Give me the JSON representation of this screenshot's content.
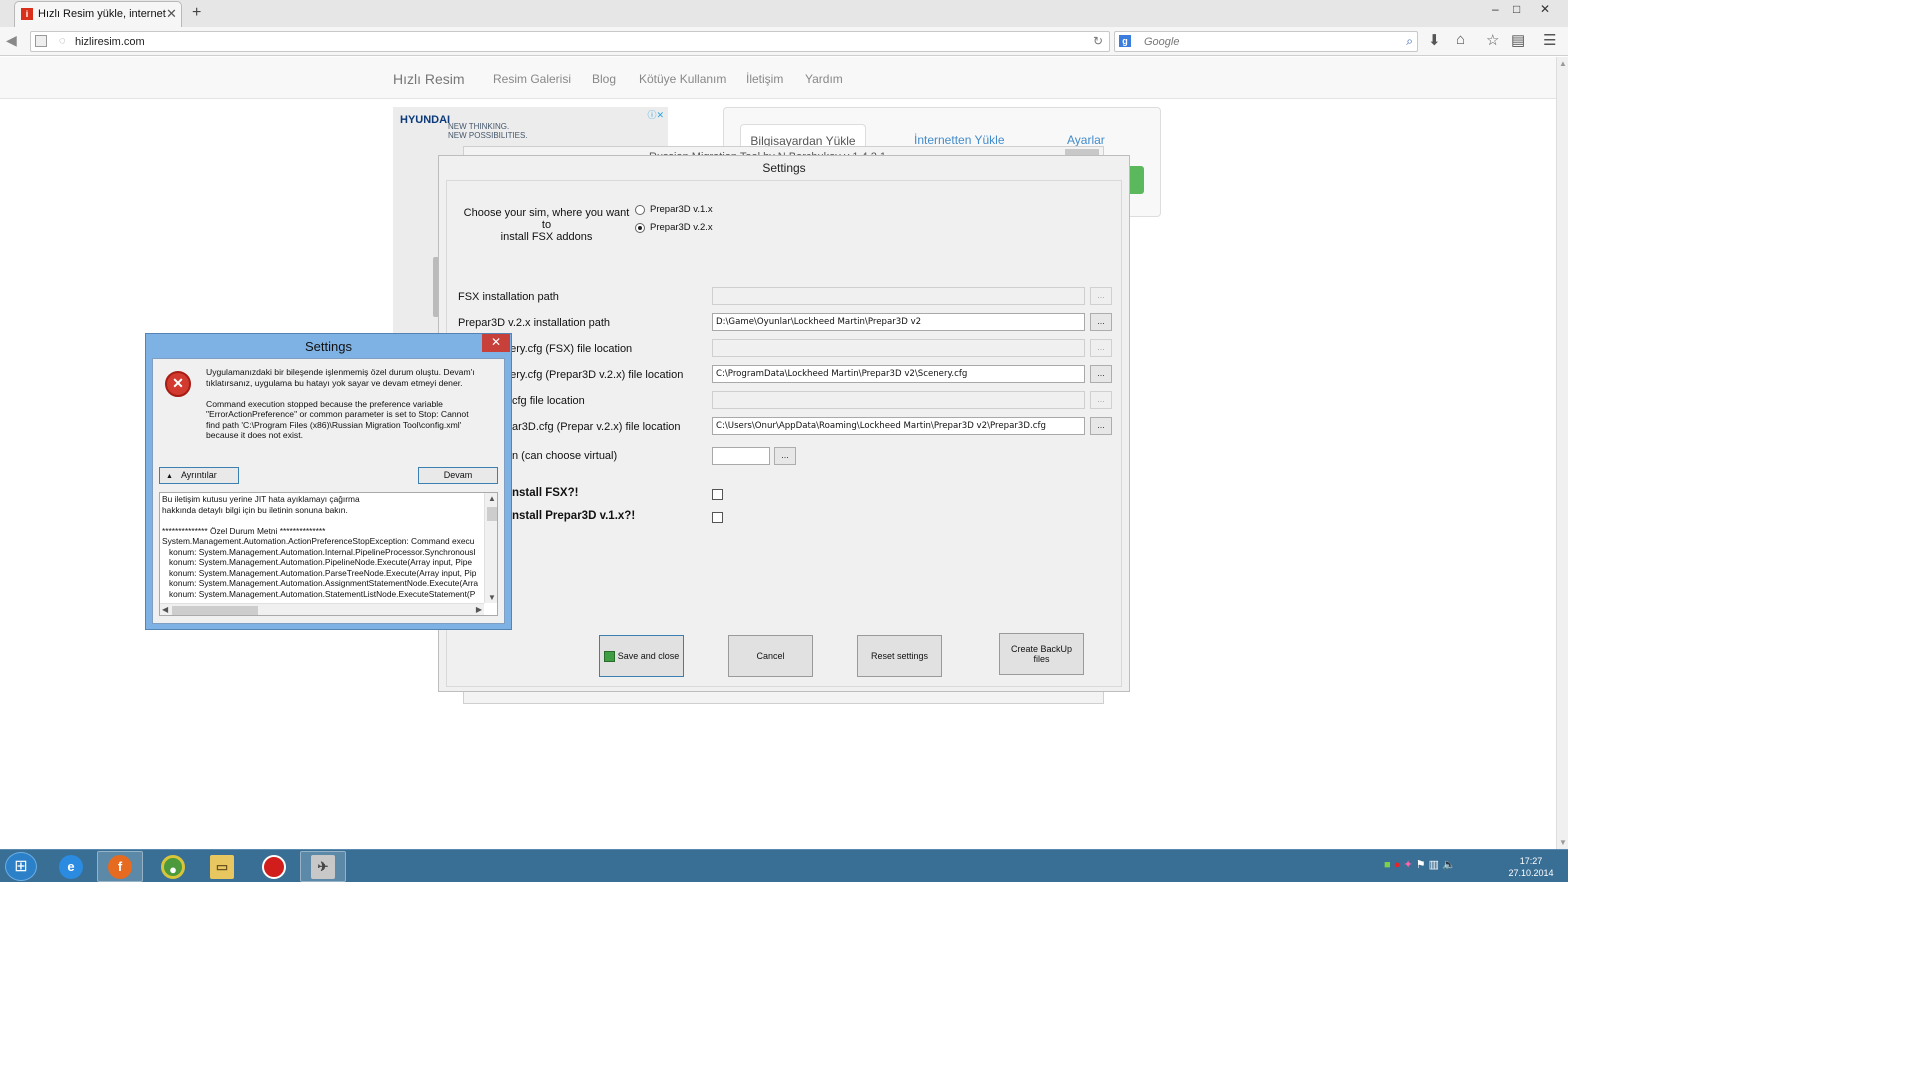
{
  "browser": {
    "tab_title": "Hızlı Resim yükle, internett...",
    "tab_icon": "letter-i-favicon",
    "new_tab": "+",
    "url": "hizliresim.com",
    "search_placeholder": "Google",
    "window_controls": [
      "–",
      "□",
      "✕"
    ]
  },
  "site": {
    "brand": "Hızlı Resim",
    "nav": [
      "Resim Galerisi",
      "Blog",
      "Kötüye Kullanım",
      "İletişim",
      "Yardım"
    ],
    "upload_tabs": [
      "Bilgisayardan Yükle",
      "İnternetten Yükle",
      "Ayarlar"
    ],
    "ad_brand": "HYUNDAI",
    "ad_tagline_1": "NEW THINKING.",
    "ad_tagline_2": "NEW POSSIBILITIES."
  },
  "bgwindow": {
    "title": "Russian Migration Tool by N.Barchukov v 1.4.2.1"
  },
  "settings": {
    "title": "Settings",
    "sim_prompt_line1": "Choose your sim, where you want to",
    "sim_prompt_line2": "install FSX addons",
    "options": [
      {
        "label": "Prepar3D v.1.x",
        "selected": false
      },
      {
        "label": "Prepar3D v.2.x",
        "selected": true
      }
    ],
    "rows": [
      {
        "label": "FSX installation path",
        "value": "",
        "enabled": false
      },
      {
        "label": "Prepar3D v.2.x installation path",
        "value": "D:\\Game\\Oyunlar\\Lockheed Martin\\Prepar3D v2",
        "enabled": true
      },
      {
        "label": "nery.cfg (FSX) file location",
        "value": "",
        "enabled": false
      },
      {
        "label": "nery.cfg (Prepar3D v.2.x) file location",
        "value": "C:\\ProgramData\\Lockheed Martin\\Prepar3D v2\\Scenery.cfg",
        "enabled": true
      },
      {
        "label": "cfg file location",
        "value": "",
        "enabled": false
      },
      {
        "label": "ar3D.cfg (Prepar v.2.x) file location",
        "value": "C:\\Users\\Onur\\AppData\\Roaming\\Lockheed Martin\\Prepar3D v2\\Prepar3D.cfg",
        "enabled": true
      }
    ],
    "virtual_label": "n (can choose virtual)",
    "virtual_value": "",
    "browse_label": "...",
    "check1_label": "nstall FSX?!",
    "check2_label": "nstall Prepar3D v.1.x?!",
    "buttons": {
      "save": "Save and close",
      "cancel": "Cancel",
      "reset": "Reset settings",
      "backup": "Create BackUp files"
    }
  },
  "error": {
    "title": "Settings",
    "close": "✕",
    "message": "Uygulamanızdaki bir bileşende işlenmemiş özel durum oluştu. Devam'ı\ntıklatırsanız, uygulama bu hatayı yok sayar ve devam etmeyi dener.\n\nCommand execution stopped because the preference variable\n\"ErrorActionPreference\" or common parameter is set to Stop: Cannot\nfind path 'C:\\Program Files (x86)\\Russian Migration Tool\\config.xml'\nbecause it does not exist.",
    "details_button": "Ayrıntılar",
    "continue_button": "Devam",
    "details_text": "Bu iletişim kutusu yerine JIT hata ayıklamayı çağırma\nhakkında detaylı bilgi için bu iletinin sonuna bakın.\n\n************** Özel Durum Metni **************\nSystem.Management.Automation.ActionPreferenceStopException: Command execu\n   konum: System.Management.Automation.Internal.PipelineProcessor.SynchronousI\n   konum: System.Management.Automation.PipelineNode.Execute(Array input, Pipe \n   konum: System.Management.Automation.ParseTreeNode.Execute(Array input, Pip\n   konum: System.Management.Automation.AssignmentStatementNode.Execute(Arra\n   konum: System.Management.Automation.StatementListNode.ExecuteStatement(P"
  },
  "taskbar": {
    "apps": [
      "internet-explorer",
      "firefox",
      "chrome",
      "file-explorer",
      "recorder",
      "migration-tool"
    ],
    "time": "17:27",
    "date": "27.10.2014"
  }
}
